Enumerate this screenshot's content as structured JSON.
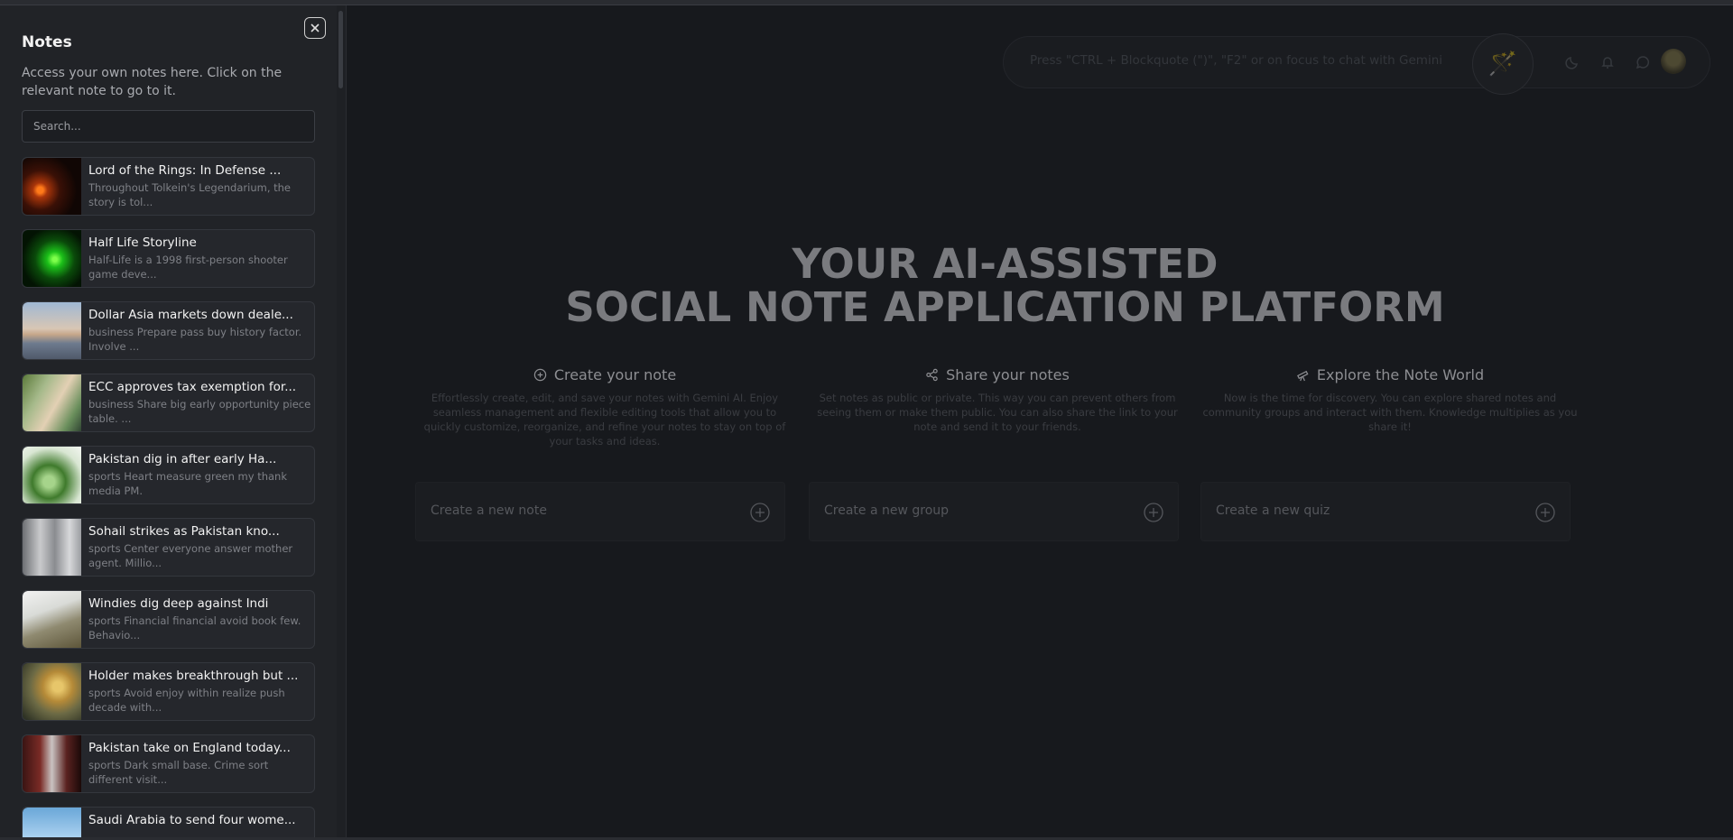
{
  "sidebar": {
    "title": "Notes",
    "description": "Access your own notes here. Click on the relevant note to go to it.",
    "search_placeholder": "Search...",
    "notes": [
      {
        "title": "Lord of the Rings: In Defense ...",
        "snippet": "Throughout Tolkein's Legendarium, the story is tol..."
      },
      {
        "title": "Half Life Storyline",
        "snippet": "Half-Life is a 1998 first-person shooter game deve..."
      },
      {
        "title": "Dollar Asia markets down deale...",
        "snippet": "business Prepare pass buy history factor. Involve ..."
      },
      {
        "title": "ECC approves tax exemption for...",
        "snippet": "business Share big early opportunity piece table. ..."
      },
      {
        "title": "Pakistan dig in after early Ha...",
        "snippet": "sports Heart measure green my thank media PM."
      },
      {
        "title": "Sohail strikes as Pakistan kno...",
        "snippet": "sports Center everyone answer mother agent. Millio..."
      },
      {
        "title": "Windies dig deep against Indi",
        "snippet": "sports Financial financial avoid book few. Behavio..."
      },
      {
        "title": "Holder makes breakthrough but ...",
        "snippet": "sports Avoid enjoy within realize push decade with..."
      },
      {
        "title": "Pakistan take on England today...",
        "snippet": "sports Dark small base. Crime sort different visit..."
      },
      {
        "title": "Saudi Arabia to send four wome...",
        "snippet": ""
      }
    ]
  },
  "topbar": {
    "chat_hint": "Press \"CTRL + Blockquote (\")\", \"F2\" or on focus to chat with Gemini",
    "magic_icon": "magic-wand-icon",
    "icons": [
      "moon-icon",
      "bell-icon",
      "chat-icon"
    ]
  },
  "hero": {
    "line1": "YOUR AI-ASSISTED",
    "line2": "SOCIAL NOTE APPLICATION PLATFORM"
  },
  "features": [
    {
      "title": "Create your note",
      "icon": "plus-circle-icon",
      "body": "Effortlessly create, edit, and save your notes with Gemini AI. Enjoy seamless management and flexible editing tools that allow you to quickly customize, reorganize, and refine your notes to stay on top of your tasks and ideas."
    },
    {
      "title": "Share your notes",
      "icon": "share-icon",
      "body": "Set notes as public or private. This way you can prevent others from seeing them or make them public. You can also share the link to your note and send it to your friends."
    },
    {
      "title": "Explore the Note World",
      "icon": "telescope-icon",
      "body": "Now is the time for discovery. You can explore shared notes and community groups and interact with them. Knowledge multiplies as you share it!"
    }
  ],
  "create_actions": [
    {
      "label": "Create a new note"
    },
    {
      "label": "Create a new group"
    },
    {
      "label": "Create a new quiz"
    }
  ]
}
